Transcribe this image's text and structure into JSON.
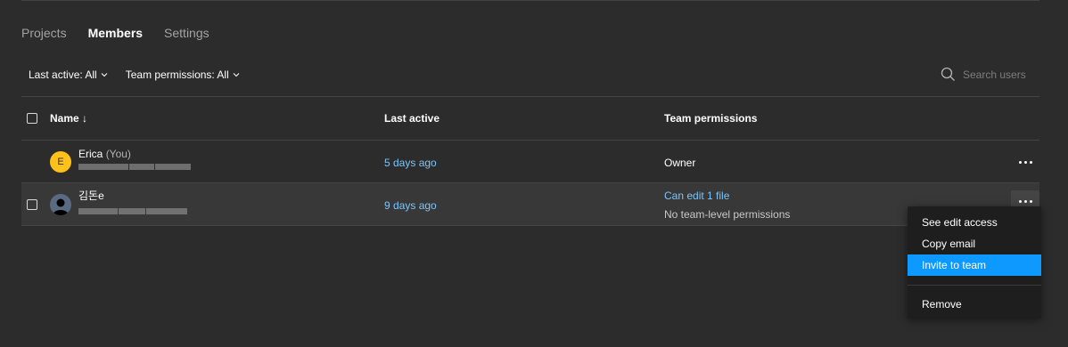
{
  "tabs": [
    {
      "label": "Projects",
      "active": false
    },
    {
      "label": "Members",
      "active": true
    },
    {
      "label": "Settings",
      "active": false
    }
  ],
  "filters": {
    "last_active": "Last active: All",
    "permissions": "Team permissions: All"
  },
  "search": {
    "placeholder": "Search users",
    "icon": "search-icon"
  },
  "table": {
    "headers": {
      "name": "Name ↓",
      "last_active": "Last active",
      "permissions": "Team permissions"
    },
    "rows": [
      {
        "avatar_letter": "E",
        "avatar_color": "#ffc21a",
        "name": "Erica",
        "tag": "(You)",
        "last_active": "5 days ago",
        "permission": "Owner"
      },
      {
        "avatar_icon": "person-icon",
        "name": "김돈e",
        "last_active": "9 days ago",
        "permission_link": "Can edit 1 file",
        "permission_note": "No team-level permissions"
      }
    ]
  },
  "menu": {
    "items": [
      "See edit access",
      "Copy email",
      "Invite to team"
    ],
    "highlighted": "Invite to team",
    "danger": "Remove"
  },
  "colors": {
    "background": "#2c2c2c",
    "link": "#7cc4f8",
    "highlight": "#0d99ff"
  }
}
